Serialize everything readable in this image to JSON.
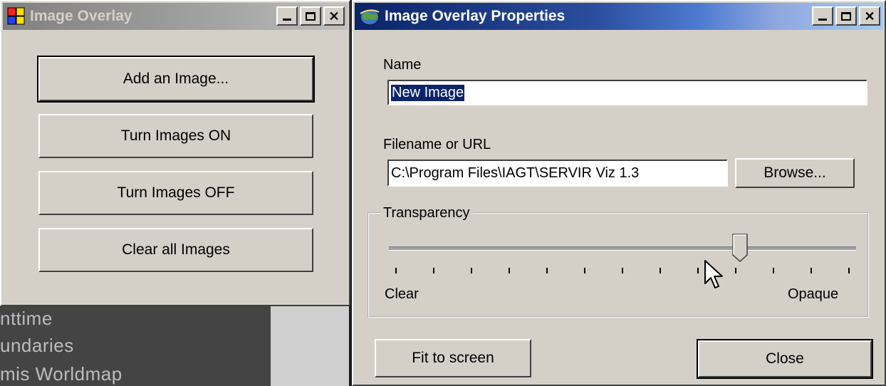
{
  "background": {
    "lines": [
      "nttime",
      "undaries",
      "mis Worldmap"
    ]
  },
  "overlay_window": {
    "title": "Image Overlay",
    "buttons": {
      "add": "Add an Image...",
      "on": "Turn Images ON",
      "off": "Turn Images OFF",
      "clear": "Clear all Images"
    }
  },
  "properties_window": {
    "title": "Image Overlay Properties",
    "name_label": "Name",
    "name_value": "New Image",
    "filename_label": "Filename or URL",
    "filename_value": "C:\\Program Files\\IAGT\\SERVIR Viz 1.3",
    "browse_label": "Browse...",
    "transparency": {
      "legend": "Transparency",
      "min_label": "Clear",
      "max_label": "Opaque",
      "value_fraction": 0.76,
      "tick_count": 13
    },
    "fit_label": "Fit to screen",
    "close_label": "Close"
  },
  "colors": {
    "window_face": "#d4d0c8",
    "active_title_start": "#0a246a",
    "active_title_end": "#a6caf0",
    "inactive_title": "#808080",
    "selection": "#0a246a"
  }
}
